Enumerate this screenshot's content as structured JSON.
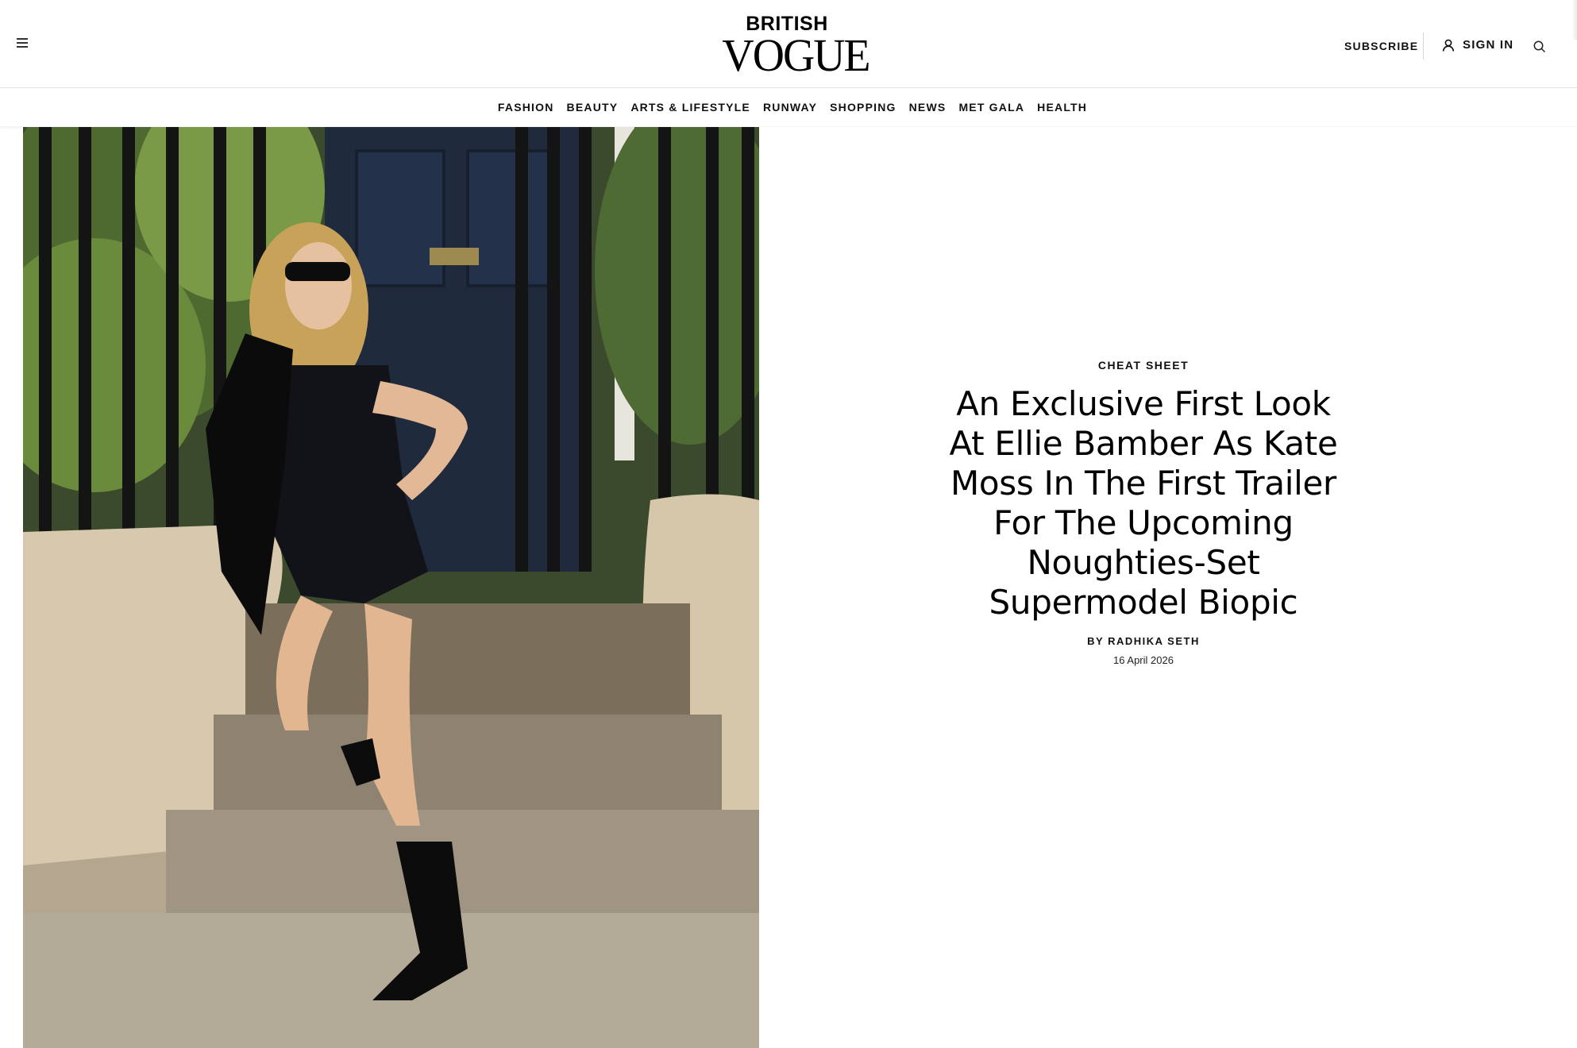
{
  "header": {
    "logo_line1": "BRITISH",
    "logo_line2": "VOGUE",
    "subscribe_label": "SUBSCRIBE",
    "signin_label": "SIGN IN",
    "icons": {
      "menu": "hamburger-menu-icon",
      "user": "user-icon",
      "search": "search-icon"
    }
  },
  "nav": {
    "items": [
      "FASHION",
      "BEAUTY",
      "ARTS & LIFESTYLE",
      "RUNWAY",
      "SHOPPING",
      "NEWS",
      "MET GALA",
      "HEALTH"
    ]
  },
  "article": {
    "rubric": "CHEAT SHEET",
    "headline": "An Exclusive First Look At Ellie Bamber As Kate Moss In The First Trailer For The Upcoming Noughties-Set Supermodel Biopic",
    "byline_prefix": "BY",
    "author": "RADHIKA SETH",
    "date": "16 April 2026"
  },
  "colors": {
    "text": "#000000",
    "border": "#e2e2e2",
    "background": "#ffffff"
  }
}
